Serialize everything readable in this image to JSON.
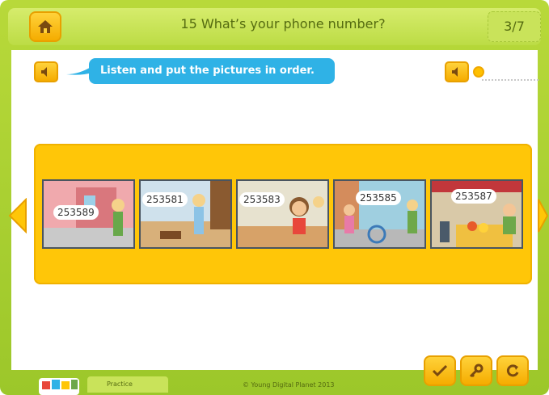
{
  "header": {
    "title": "15 What’s your phone number?",
    "counter": "3/7",
    "home_icon": "home-icon"
  },
  "instruction": {
    "text": "Listen and put the pictures in order.",
    "speaker_icon": "speaker-icon"
  },
  "volume": {
    "icon": "speaker-icon"
  },
  "pictures": [
    {
      "number": "253589"
    },
    {
      "number": "253581"
    },
    {
      "number": "253583"
    },
    {
      "number": "253585"
    },
    {
      "number": "253587"
    }
  ],
  "footer": {
    "tab_label": "Practice",
    "copyright": "© Young Digital Planet 2013"
  },
  "actions": [
    {
      "icon": "check-icon"
    },
    {
      "icon": "key-icon"
    },
    {
      "icon": "reset-icon"
    }
  ],
  "colors": {
    "frame_green": "#b8d93a",
    "accent_yellow": "#ffc608",
    "bubble_blue": "#2fb2e6"
  }
}
